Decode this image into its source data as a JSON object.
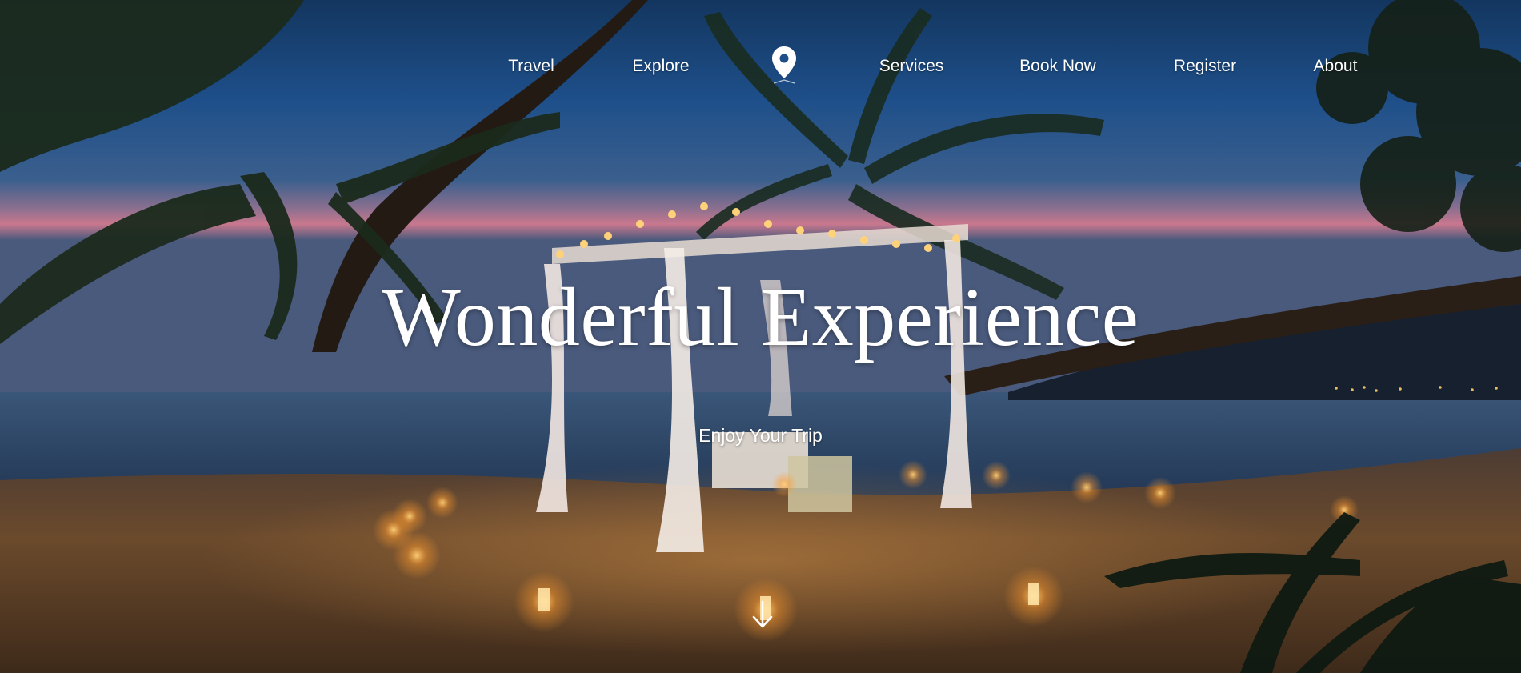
{
  "nav": {
    "items": [
      {
        "label": "Travel"
      },
      {
        "label": "Explore"
      },
      {
        "label": "Services"
      },
      {
        "label": "Book Now"
      },
      {
        "label": "Register"
      },
      {
        "label": "About"
      }
    ],
    "logo_icon": "map-pin-icon"
  },
  "hero": {
    "title": "Wonderful Experience",
    "subtitle": "Enjoy Your Trip",
    "scroll_icon": "arrow-down-icon",
    "background_scene": "beach-dinner-at-dusk-photo"
  },
  "colors": {
    "text": "#ffffff",
    "sky_top": "#1e4f8a",
    "sunset_glow": "#c9788e",
    "sea": "#2c4a6e",
    "sand": "#6b4a2c",
    "candle": "#ffb347"
  }
}
